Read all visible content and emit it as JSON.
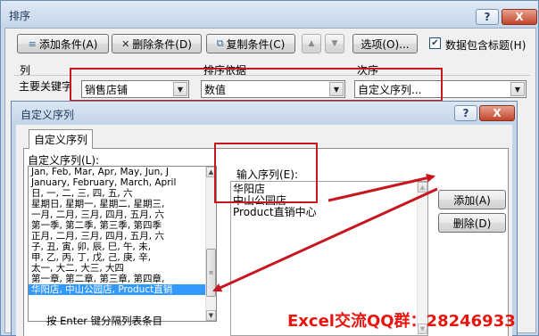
{
  "sort_dialog": {
    "title": "排序",
    "help_button": "?",
    "close_button": "X",
    "toolbar": {
      "add_level": "添加条件(A)",
      "delete_level": "删除条件(D)",
      "copy_level": "复制条件(C)",
      "move_up": "▲",
      "move_down": "▼",
      "options": "选项(O)...",
      "header_checkbox_label": "数据包含标题(H)",
      "header_checkbox_checked": true
    },
    "columns": {
      "column": "列",
      "sort_on": "排序依据",
      "order": "次序"
    },
    "row": {
      "label": "主要关键字",
      "column_value": "销售店铺",
      "sort_on_value": "数值",
      "order_value": "自定义序列..."
    }
  },
  "custom_lists_dialog": {
    "title": "自定义序列",
    "help_button": "?",
    "close_button": "X",
    "tab_label": "自定义序列",
    "lists_label": "自定义序列(L):",
    "lists": [
      "Jan, Feb, Mar, Apr, May, Jun, J",
      "January, February, March, April",
      "日, 一, 二, 三, 四, 五, 六",
      "星期日, 星期一, 星期二, 星期三,",
      "一月, 二月, 三月, 四月, 五月, 六",
      "第一季, 第二季, 第三季, 第四季",
      "正月, 二月, 三月, 四月, 五月, 六",
      "子, 丑, 寅, 卯, 辰, 巳, 午, 未,",
      "甲, 乙, 丙, 丁, 戊, 己, 庚, 辛,",
      "太一, 大二, 大三, 大四",
      "第一章, 第二章, 第三章, 第四章,",
      "华阳店, 中山公园店, Product直销"
    ],
    "selected_list_index": 11,
    "entries_label": "输入序列(E):",
    "entries": [
      "华阳店",
      "中山公园店",
      "Product直销中心"
    ],
    "add_button": "添加(A)",
    "delete_button": "删除(D)",
    "hint": "按 Enter 键分隔列表条目"
  },
  "watermark": "Excel交流QQ群：28246933",
  "colors": {
    "annotation_red": "#c8161e",
    "selection_blue": "#3399ff",
    "watermark_red": "#e8150f"
  },
  "icons": {
    "add_level": "add-rows-icon",
    "delete_level": "delete-x-icon",
    "copy_level": "copy-icon",
    "move_up": "arrow-up-icon",
    "move_down": "arrow-down-icon"
  }
}
